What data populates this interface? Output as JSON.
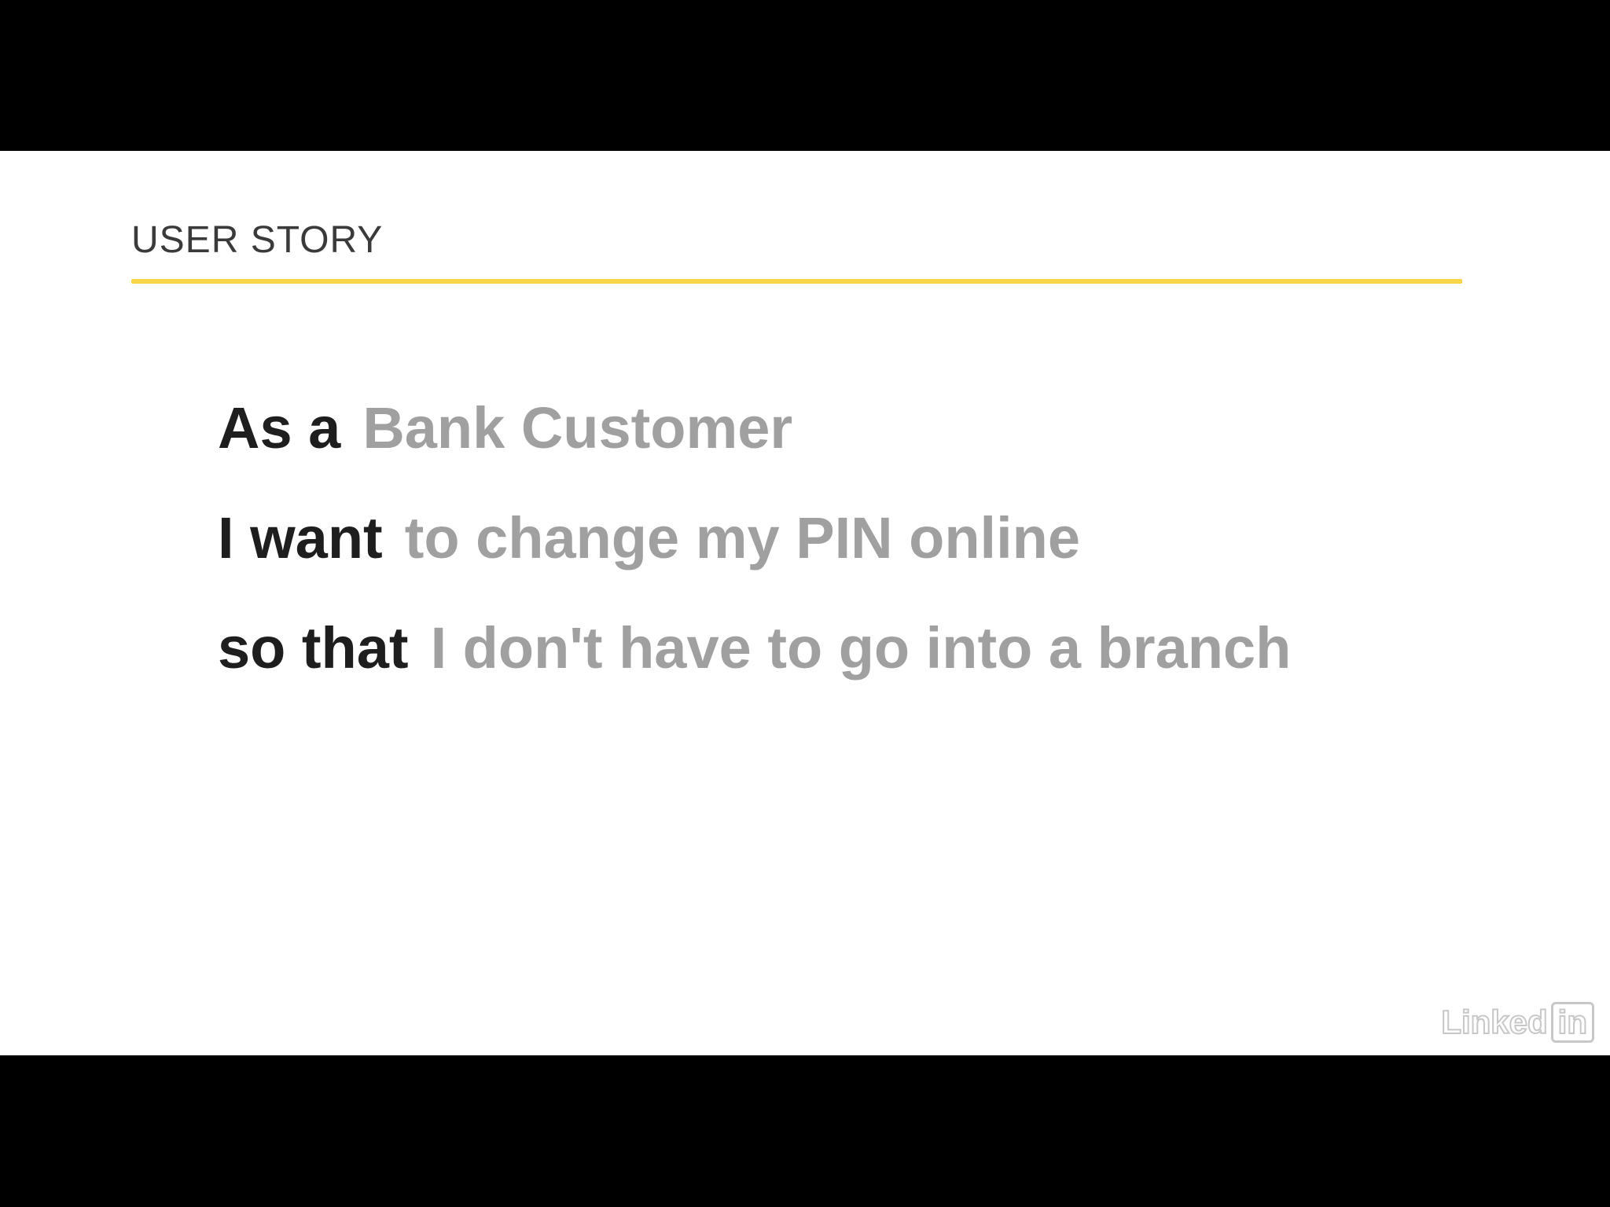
{
  "slide": {
    "section_title": "USER STORY",
    "accent_color": "#f9d54a",
    "story": [
      {
        "keyword": "As a",
        "value": "Bank Customer"
      },
      {
        "keyword": "I want",
        "value": "to change my PIN online"
      },
      {
        "keyword": "so that",
        "value": "I don't have to go into a branch"
      }
    ]
  },
  "watermark": {
    "text_part": "Linked",
    "box_part": "in"
  }
}
